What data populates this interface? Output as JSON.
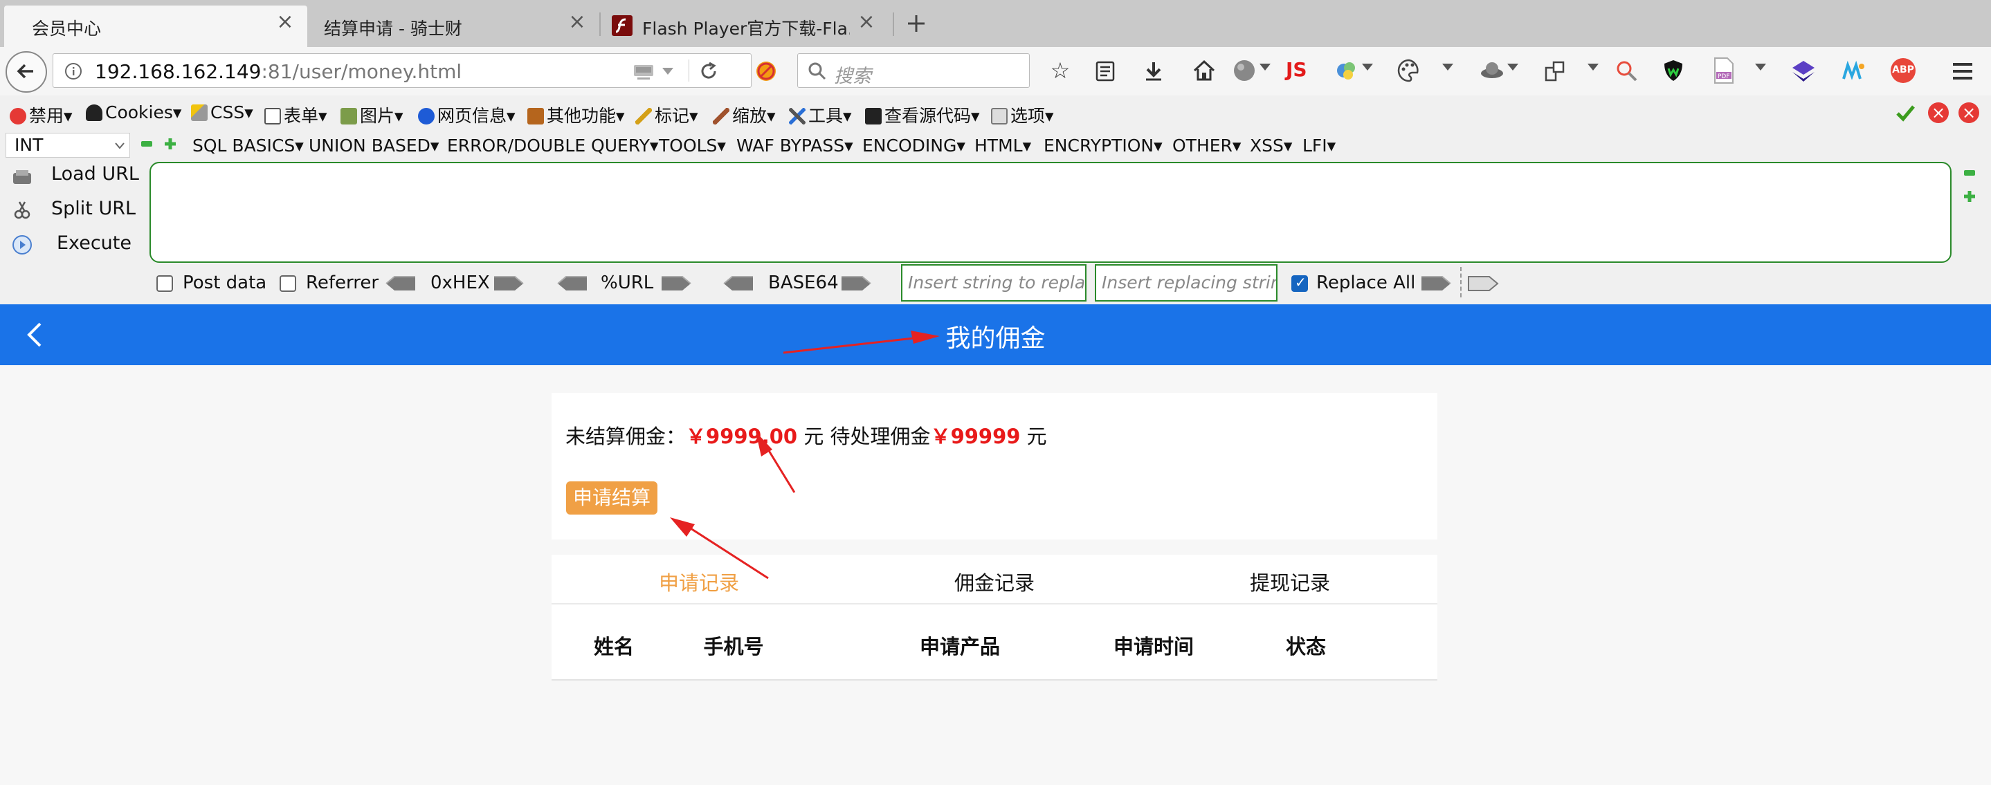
{
  "browser": {
    "tabs": [
      {
        "title": "会员中心",
        "active": true
      },
      {
        "title": "结算申请 - 骑士财",
        "active": false
      },
      {
        "title": "Flash Player官方下载-Fla...",
        "active": false
      }
    ],
    "new_tab_icon": "plus-icon",
    "url": {
      "host": "192.168.162.149",
      "port": ":81",
      "path": "/user/money.html"
    },
    "search_placeholder": "搜索",
    "menu": [
      "禁用▾",
      "Cookies▾",
      "CSS▾",
      "表单▾",
      "图片▾",
      "网页信息▾",
      "其他功能▾",
      "标记▾",
      "缩放▾",
      "工具▾",
      "查看源代码▾",
      "选项▾"
    ],
    "js_label": "JS",
    "abp_label": "ABP"
  },
  "hackbar": {
    "type_select": "INT",
    "menu": [
      "SQL BASICS▾",
      "UNION BASED▾",
      "ERROR/DOUBLE QUERY▾",
      "TOOLS▾",
      "WAF BYPASS▾",
      "ENCODING▾",
      "HTML▾",
      "ENCRYPTION▾",
      "OTHER▾",
      "XSS▾",
      "LFI▾"
    ],
    "actions": [
      "Load URL",
      "Split URL",
      "Execute"
    ],
    "post_data_label": "Post data",
    "referrer_label": "Referrer",
    "hex_label": "0xHEX",
    "url_label": "%URL",
    "base64_label": "BASE64",
    "replace_placeholder": "Insert string to replace",
    "replacing_placeholder": "Insert replacing string",
    "replace_all_label": "Replace All",
    "replace_all_checked": true
  },
  "page": {
    "title": "我的佣金",
    "summary": {
      "unsettled_label": "未结算佣金：",
      "unsettled_amount": "￥9999.00",
      "unit1": " 元 ",
      "pending_label": "待处理佣金",
      "pending_amount": "￥99999",
      "unit2": " 元"
    },
    "apply_button": "申请结算",
    "tabs": [
      "申请记录",
      "佣金记录",
      "提现记录"
    ],
    "active_tab": 0,
    "columns": [
      "姓名",
      "手机号",
      "申请产品",
      "申请时间",
      "状态"
    ]
  },
  "colors": {
    "header_blue": "#1a73e8",
    "accent_orange": "#f0a045",
    "money_red": "#e81a1a",
    "annotation_red": "#e52222"
  }
}
